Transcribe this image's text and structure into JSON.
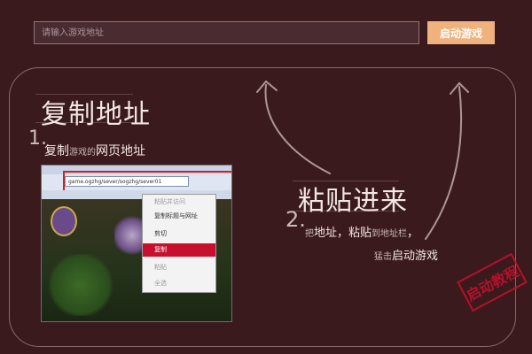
{
  "search": {
    "placeholder": "请输入游戏地址",
    "value": ""
  },
  "start_button": {
    "label": "启动游戏"
  },
  "step1": {
    "title": "复制地址",
    "number": "1.",
    "text_part1": "复制",
    "text_part2": "游戏的",
    "text_part3": "网页地址"
  },
  "screenshot": {
    "url_text": "game.ogzhg/sever/sogzhg/sever01",
    "context_menu": {
      "items": [
        "粘贴并访问",
        "复制标题与网址",
        "剪切",
        "复制",
        "粘贴",
        "全选"
      ],
      "highlighted": "复制"
    }
  },
  "step2": {
    "title": "粘贴进来",
    "number": "2.",
    "line1_part1": "把",
    "line1_part2": "地址",
    "line1_part3": "，",
    "line1_part4": "粘贴",
    "line1_part5": "到地址栏",
    "line1_part6": "，",
    "line2_part1": "猛击",
    "line2_part2": "启动游戏"
  },
  "stamp": "启动教程",
  "colors": {
    "background": "#3b1a1e",
    "button": "#f0b27d",
    "highlight_red": "#c8102e"
  }
}
